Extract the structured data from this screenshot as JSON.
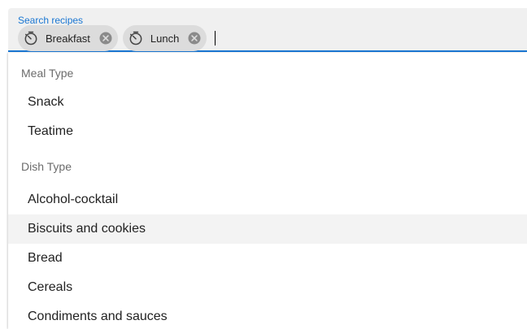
{
  "search": {
    "label": "Search recipes",
    "value": "",
    "chips": [
      {
        "label": "Breakfast",
        "icon": "timer-icon"
      },
      {
        "label": "Lunch",
        "icon": "timer-icon"
      }
    ]
  },
  "dropdown": {
    "groups": [
      {
        "title": "Meal Type",
        "options": [
          "Snack",
          "Teatime"
        ]
      },
      {
        "title": "Dish Type",
        "options": [
          "Alcohol-cocktail",
          "Biscuits and cookies",
          "Bread",
          "Cereals",
          "Condiments and sauces"
        ]
      }
    ],
    "highlighted_option": "Biscuits and cookies"
  },
  "colors": {
    "accent": "#1976d2",
    "field_bg": "#f0f0f0",
    "chip_bg": "#dcdcdc",
    "highlight_bg": "#f3f3f3"
  }
}
